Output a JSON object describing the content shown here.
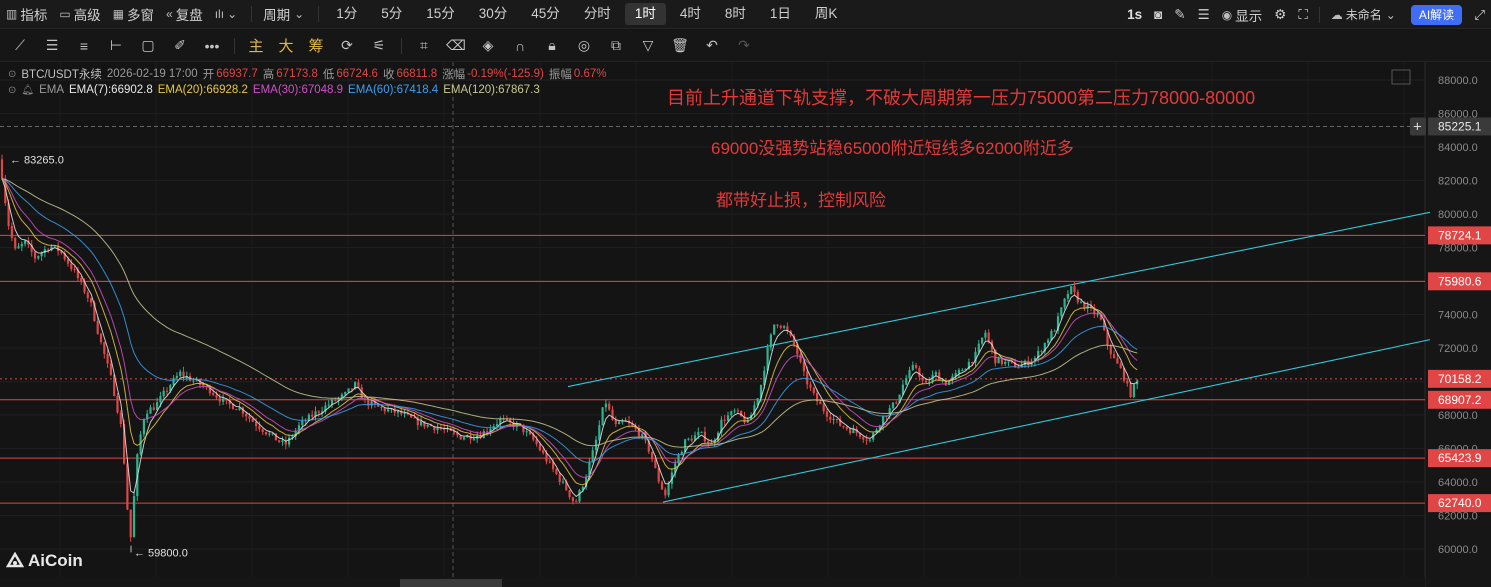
{
  "toolbar": {
    "indicators": "指标",
    "advanced": "高级",
    "multi_window": "多窗",
    "replay": "复盘",
    "period": "周期",
    "timeframes": [
      "1分",
      "5分",
      "15分",
      "30分",
      "45分",
      "分时",
      "1时",
      "4时",
      "8时",
      "1日",
      "周K"
    ],
    "active_timeframe": "1时",
    "interval_1s": "1s",
    "display": "显示",
    "layout_name": "未命名",
    "ai_label": "AI解读"
  },
  "draw_tools": {
    "main": "主",
    "big": "大",
    "chip": "筹"
  },
  "info": {
    "symbol": "BTC/USDT永续",
    "datetime": "2026-02-19 17:00",
    "open_label": "开",
    "open": "66937.7",
    "high_label": "高",
    "high": "67173.8",
    "low_label": "低",
    "low": "66724.6",
    "close_label": "收",
    "close": "66811.8",
    "change_label": "涨幅",
    "change": "-0.19%(-125.9)",
    "amp_label": "振幅",
    "amp": "0.67%",
    "ema_name": "EMA",
    "ema_values": [
      {
        "label": "EMA(7):66902.8",
        "color": "#e8e8e8"
      },
      {
        "label": "EMA(20):66928.2",
        "color": "#e8c840"
      },
      {
        "label": "EMA(30):67048.9",
        "color": "#d050c8"
      },
      {
        "label": "EMA(60):67418.4",
        "color": "#3aa0f0"
      },
      {
        "label": "EMA(120):67867.3",
        "color": "#c8c890"
      }
    ]
  },
  "annotations": [
    "目前上升通道下轨支撑，不破大周期第一压力75000第二压力78000-80000",
    "69000没强势站稳65000附近短线多62000附近多",
    "都带好止损，控制风险"
  ],
  "logo": "AiCoin",
  "colors": {
    "up": "#2bb58f",
    "down": "#e04646",
    "hline": "#e04646",
    "channel": "#30c8d8",
    "accent": "#3f6df5"
  },
  "chart_data": {
    "type": "candlestick",
    "symbol": "BTC/USDT永续",
    "timeframe": "1时",
    "ylim": [
      59000,
      88500
    ],
    "y_ticks": [
      "88000.0",
      "86000.0",
      "84000.0",
      "82000.0",
      "80000.0",
      "78000.0",
      "76000.0",
      "74000.0",
      "72000.0",
      "70000.0",
      "68000.0",
      "66000.0",
      "64000.0",
      "62000.0",
      "60000.0"
    ],
    "price_path": [
      [
        0,
        83265
      ],
      [
        8,
        79500
      ],
      [
        15,
        77800
      ],
      [
        25,
        78300
      ],
      [
        35,
        77400
      ],
      [
        50,
        78100
      ],
      [
        60,
        77800
      ],
      [
        75,
        76500
      ],
      [
        90,
        74800
      ],
      [
        100,
        72500
      ],
      [
        112,
        70000
      ],
      [
        122,
        67000
      ],
      [
        130,
        60200
      ],
      [
        138,
        66000
      ],
      [
        145,
        68200
      ],
      [
        155,
        68500
      ],
      [
        170,
        69800
      ],
      [
        180,
        70500
      ],
      [
        195,
        70000
      ],
      [
        210,
        69500
      ],
      [
        225,
        68700
      ],
      [
        240,
        68400
      ],
      [
        255,
        67500
      ],
      [
        270,
        66800
      ],
      [
        285,
        66200
      ],
      [
        300,
        67400
      ],
      [
        315,
        68100
      ],
      [
        330,
        68700
      ],
      [
        345,
        69200
      ],
      [
        355,
        69800
      ],
      [
        365,
        68800
      ],
      [
        380,
        68400
      ],
      [
        400,
        68100
      ],
      [
        420,
        67500
      ],
      [
        440,
        67200
      ],
      [
        460,
        66700
      ],
      [
        480,
        66800
      ],
      [
        500,
        67700
      ],
      [
        520,
        67300
      ],
      [
        535,
        66400
      ],
      [
        550,
        65000
      ],
      [
        565,
        63700
      ],
      [
        575,
        62700
      ],
      [
        585,
        64200
      ],
      [
        595,
        66200
      ],
      [
        605,
        68900
      ],
      [
        615,
        67300
      ],
      [
        625,
        67600
      ],
      [
        640,
        66900
      ],
      [
        650,
        65800
      ],
      [
        658,
        64200
      ],
      [
        665,
        63200
      ],
      [
        675,
        65100
      ],
      [
        685,
        66400
      ],
      [
        700,
        66900
      ],
      [
        712,
        66200
      ],
      [
        722,
        67700
      ],
      [
        735,
        68200
      ],
      [
        748,
        67500
      ],
      [
        760,
        69500
      ],
      [
        768,
        72000
      ],
      [
        775,
        73600
      ],
      [
        785,
        73200
      ],
      [
        795,
        72100
      ],
      [
        805,
        70200
      ],
      [
        815,
        69000
      ],
      [
        825,
        68200
      ],
      [
        840,
        67400
      ],
      [
        855,
        67000
      ],
      [
        870,
        66500
      ],
      [
        882,
        67800
      ],
      [
        895,
        68700
      ],
      [
        905,
        70100
      ],
      [
        915,
        71000
      ],
      [
        925,
        69700
      ],
      [
        935,
        70500
      ],
      [
        945,
        69900
      ],
      [
        955,
        70300
      ],
      [
        965,
        70900
      ],
      [
        975,
        71500
      ],
      [
        985,
        73000
      ],
      [
        995,
        71300
      ],
      [
        1005,
        71100
      ],
      [
        1020,
        70900
      ],
      [
        1035,
        71400
      ],
      [
        1045,
        72300
      ],
      [
        1055,
        73200
      ],
      [
        1062,
        74400
      ],
      [
        1070,
        75600
      ],
      [
        1080,
        74700
      ],
      [
        1090,
        74300
      ],
      [
        1100,
        73800
      ],
      [
        1108,
        72100
      ],
      [
        1115,
        71200
      ],
      [
        1122,
        70600
      ],
      [
        1130,
        69200
      ],
      [
        1138,
        70100
      ]
    ],
    "emas": [
      {
        "name": "EMA(7)",
        "value": 66902.8,
        "color": "#e8e8e8",
        "lag": 4
      },
      {
        "name": "EMA(20)",
        "value": 66928.2,
        "color": "#e8c840",
        "lag": 10
      },
      {
        "name": "EMA(30)",
        "value": 67048.9,
        "color": "#d050c8",
        "lag": 15
      },
      {
        "name": "EMA(60)",
        "value": 67418.4,
        "color": "#3aa0f0",
        "lag": 30
      },
      {
        "name": "EMA(120)",
        "value": 67867.3,
        "color": "#c8c890",
        "lag": 60
      }
    ],
    "horizontal_levels": [
      {
        "value": 78724.1,
        "label": "78724.1",
        "style": "solid"
      },
      {
        "value": 75980.6,
        "label": "75980.6",
        "style": "solid"
      },
      {
        "value": 68907.2,
        "label": "68907.2",
        "style": "solid"
      },
      {
        "value": 65423.9,
        "label": "65423.9",
        "style": "solid"
      },
      {
        "value": 62740.0,
        "label": "62740.0",
        "style": "solid"
      },
      {
        "value": 70158.2,
        "label": "70158.2",
        "style": "dotted"
      }
    ],
    "crosshair": {
      "price": 85225.1,
      "label": "85225.1"
    },
    "current_price": {
      "value": 70158.2,
      "label": "70158.2"
    },
    "high_marker": {
      "value": 83265.0,
      "label": "83265.0"
    },
    "low_marker": {
      "value": 59800.0,
      "label": "59800.0"
    },
    "channel_lines": [
      {
        "name": "upper",
        "from": [
          568,
          69700
        ],
        "to": [
          1430,
          80100
        ]
      },
      {
        "name": "lower",
        "from": [
          663,
          62800
        ],
        "to": [
          1430,
          72500
        ]
      }
    ]
  }
}
